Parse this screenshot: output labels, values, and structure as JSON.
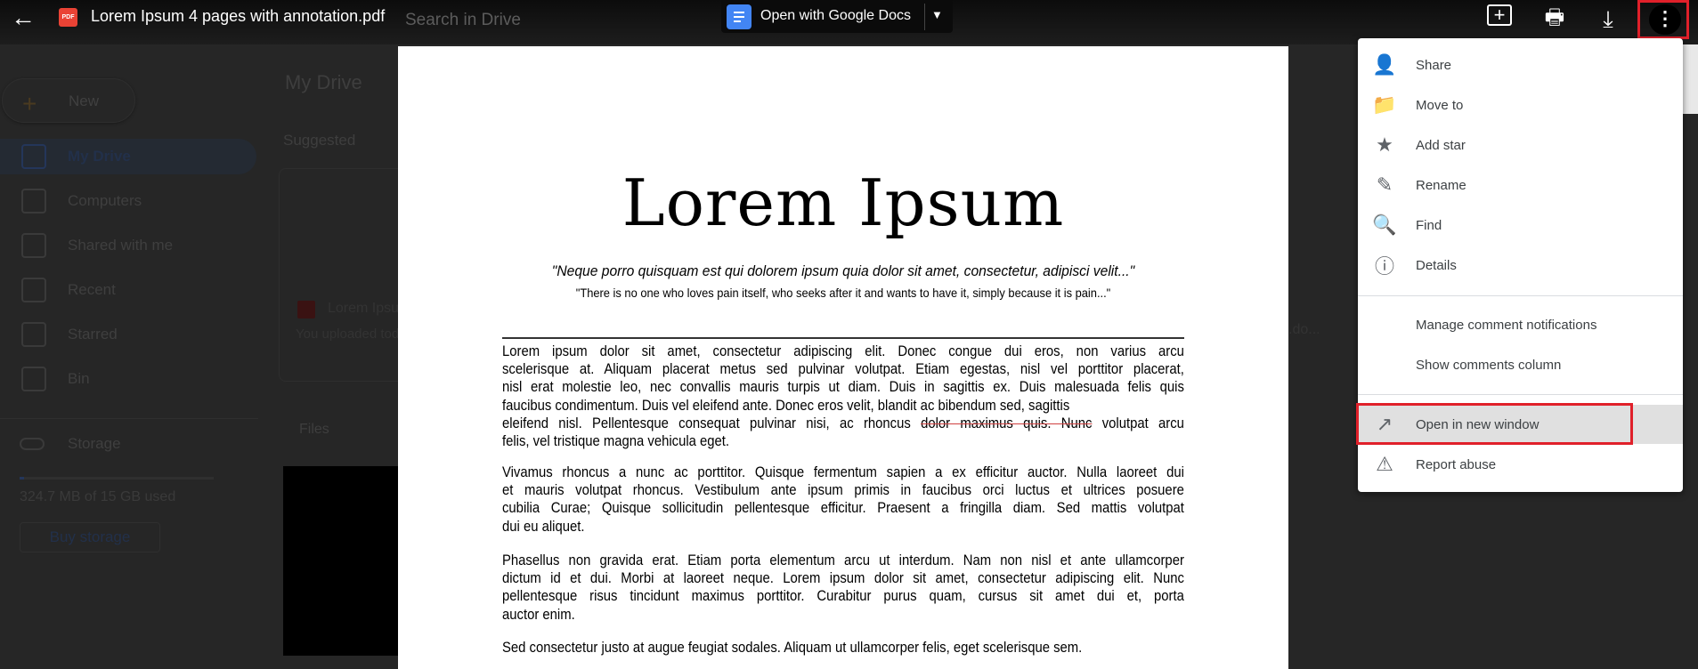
{
  "viewer": {
    "title": "Lorem Ipsum 4 pages with annotation.pdf",
    "file_badge": "PDF",
    "open_with_label": "Open with Google Docs",
    "icons": [
      "back-arrow-icon",
      "pdf-icon",
      "google-docs-icon",
      "chevron-down-icon",
      "add-comment-icon",
      "print-icon",
      "download-icon",
      "more-vert-icon"
    ]
  },
  "drive_bg": {
    "search_placeholder": "Search in Drive",
    "new_label": "New",
    "sidebar": [
      {
        "label": "My Drive",
        "icon": "my-drive-icon"
      },
      {
        "label": "Computers",
        "icon": "computers-icon"
      },
      {
        "label": "Shared with me",
        "icon": "shared-icon"
      },
      {
        "label": "Recent",
        "icon": "clock-icon"
      },
      {
        "label": "Starred",
        "icon": "star-icon"
      },
      {
        "label": "Bin",
        "icon": "trash-icon"
      }
    ],
    "storage_label": "Storage",
    "storage_used": "324.7 MB of 15 GB used",
    "storage_fraction": 0.021,
    "buy_storage": "Buy storage",
    "main_title": "My Drive",
    "suggested": "Suggested",
    "card_name": "Lorem Ipsu",
    "card_sub": "You uploaded tod",
    "card2_name": ".do...",
    "files": "Files"
  },
  "document": {
    "title": "Lorem Ipsum",
    "quote1": "\"Neque porro quisquam est qui dolorem ipsum quia dolor sit amet, consectetur, adipisci velit...\"",
    "quote2": "\"There is no one who loves pain itself, who seeks after it and wants to have it, simply because it is pain...\"",
    "p1": [
      "Lorem ipsum dolor sit amet, consectetur adipiscing elit. Donec congue dui eros, non varius arcu",
      "scelerisque at. Aliquam placerat metus sed pulvinar volutpat. Etiam egestas, nisl vel porttitor placerat,",
      "nisl erat molestie leo, nec convallis mauris turpis ut diam. Duis in sagittis ex. Duis malesuada felis quis",
      "faucibus condimentum. Duis vel eleifend ante. Donec eros velit, blandit ac bibendum sed, sagittis"
    ],
    "p1_annot": {
      "before": "eleifend nisl. Pellentesque consequat pulvinar nisi, ac rhoncus ",
      "struck": "dolor maximus quis. Nunc",
      "after": " volutpat arcu"
    },
    "p1_last": "felis, vel tristique magna vehicula eget.",
    "p2": [
      "Vivamus rhoncus a nunc ac porttitor. Quisque fermentum sapien a ex efficitur auctor. Nulla laoreet dui",
      "et mauris volutpat rhoncus. Vestibulum ante ipsum primis in faucibus orci luctus et ultrices posuere",
      "cubilia Curae; Quisque sollicitudin pellentesque efficitur. Praesent a fringilla diam. Sed mattis volutpat",
      "dui eu aliquet."
    ],
    "p3": [
      "Phasellus non gravida erat. Etiam porta elementum arcu ut interdum. Nam non nisl et ante ullamcorper",
      "dictum id et dui. Morbi at laoreet neque. Lorem ipsum dolor sit amet, consectetur adipiscing elit. Nunc",
      "pellentesque risus tincidunt maximus porttitor. Curabitur purus quam, cursus sit amet dui et, porta",
      "auctor enim."
    ],
    "p4": [
      "Sed consectetur justo at augue feugiat sodales. Aliquam ut ullamcorper felis, eget scelerisque sem."
    ]
  },
  "menu": {
    "items": [
      {
        "label": "Share",
        "icon": "person-add-icon"
      },
      {
        "label": "Move to",
        "icon": "move-folder-icon"
      },
      {
        "label": "Add star",
        "icon": "star-icon"
      },
      {
        "label": "Rename",
        "icon": "pencil-icon"
      },
      {
        "label": "Find",
        "icon": "find-in-page-icon"
      },
      {
        "label": "Details",
        "icon": "info-icon"
      },
      {
        "label": "Manage comment notifications"
      },
      {
        "label": "Show comments column"
      },
      {
        "label": "Open in new window",
        "icon": "open-in-new-icon",
        "highlighted": true
      },
      {
        "label": "Report abuse",
        "icon": "report-icon"
      }
    ]
  },
  "colors": {
    "highlight_box": "#e0202a",
    "pdf_red": "#ea4335",
    "docs_blue": "#4285f4",
    "menu_hover": "#e0e0e0"
  }
}
